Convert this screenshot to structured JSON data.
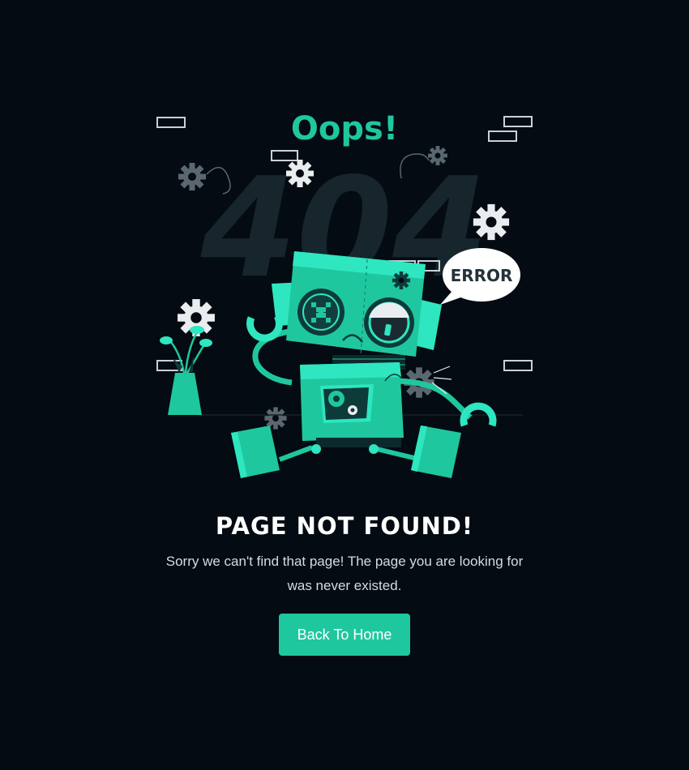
{
  "illustration": {
    "oops_text": "Oops!",
    "big_code_text": "404",
    "bubble_text": "ERROR"
  },
  "content": {
    "heading": "PAGE NOT FOUND!",
    "description": "Sorry we can't find that page! The page you are looking for was never existed.",
    "button_label": "Back To Home"
  },
  "colors": {
    "background": "#040b12",
    "accent": "#1fc79f",
    "accent_light": "#2ee6c0",
    "heading": "#ffffff",
    "body_text": "#d4dbe2"
  },
  "icons": [
    "gear-icon",
    "speech-bubble-icon",
    "robot-illustration",
    "plant-pot-icon"
  ]
}
